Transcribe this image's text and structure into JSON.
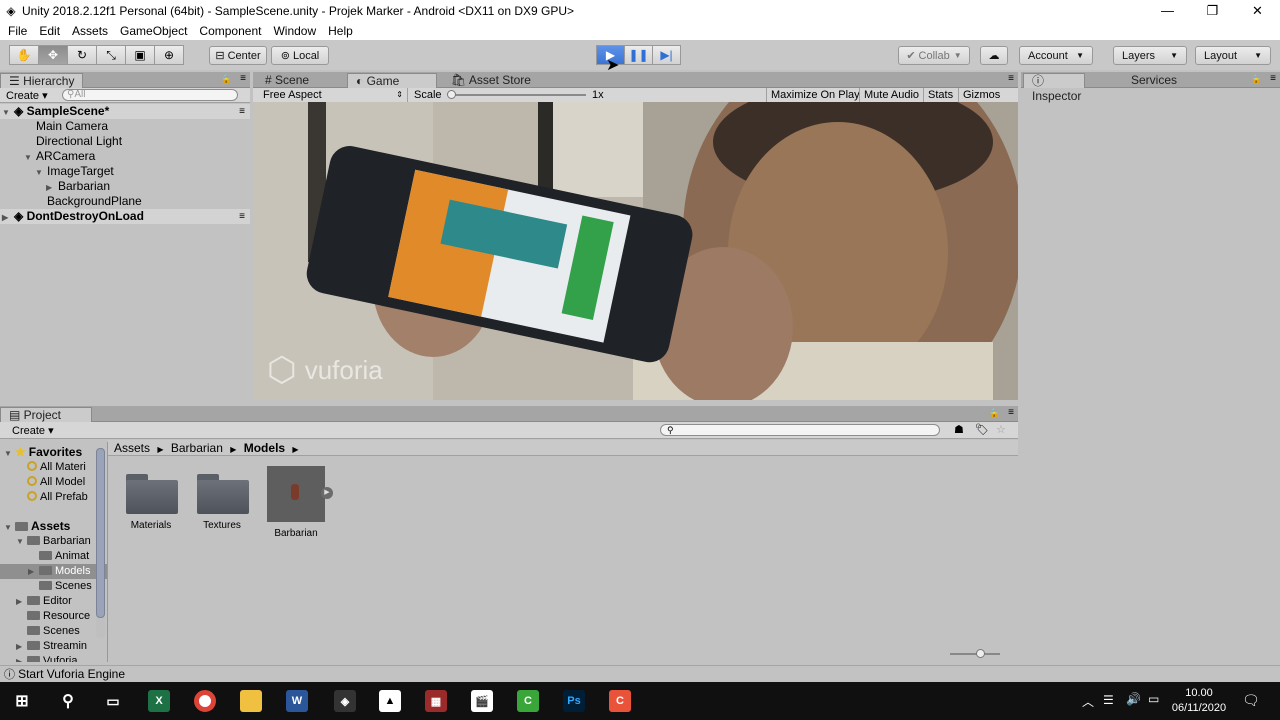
{
  "window": {
    "title": "Unity 2018.2.12f1 Personal (64bit) - SampleScene.unity - Projek Marker - Android <DX11 on DX9 GPU>",
    "controls": [
      "—",
      "❐",
      "✕"
    ]
  },
  "menu": [
    "File",
    "Edit",
    "Assets",
    "GameObject",
    "Component",
    "Window",
    "Help"
  ],
  "toolbar": {
    "center_label": "Center",
    "local_label": "Local",
    "collab_label": "Collab",
    "account_label": "Account",
    "layers_label": "Layers",
    "layout_label": "Layout"
  },
  "hierarchy": {
    "tab": "Hierarchy",
    "create": "Create",
    "search_placeholder": "All",
    "items": [
      {
        "label": "SampleScene*",
        "indent": 0,
        "arrow": "▼",
        "scene": true
      },
      {
        "label": "Main Camera",
        "indent": 2,
        "arrow": ""
      },
      {
        "label": "Directional Light",
        "indent": 2,
        "arrow": ""
      },
      {
        "label": "ARCamera",
        "indent": 2,
        "arrow": "▼"
      },
      {
        "label": "ImageTarget",
        "indent": 3,
        "arrow": "▼"
      },
      {
        "label": "Barbarian",
        "indent": 4,
        "arrow": "▶"
      },
      {
        "label": "BackgroundPlane",
        "indent": 3,
        "arrow": ""
      },
      {
        "label": "DontDestroyOnLoad",
        "indent": 0,
        "arrow": "▶",
        "scene": true
      }
    ]
  },
  "view_tabs": {
    "scene": "Scene",
    "game": "Game",
    "asset_store": "Asset Store"
  },
  "game": {
    "aspect": "Free Aspect",
    "scale_label": "Scale",
    "scale_value": "1x",
    "maximize": "Maximize On Play",
    "mute": "Mute Audio",
    "stats": "Stats",
    "gizmos": "Gizmos",
    "watermark": "vuforia"
  },
  "inspector": {
    "tab": "Inspector",
    "services_tab": "Services"
  },
  "project": {
    "tab": "Project",
    "create": "Create",
    "breadcrumb": [
      "Assets",
      "Barbarian",
      "Models"
    ],
    "favorites": {
      "label": "Favorites",
      "items": [
        "All Materi",
        "All Model",
        "All Prefab"
      ]
    },
    "assets": {
      "label": "Assets",
      "items": [
        {
          "label": "Barbarian",
          "indent": 1,
          "arrow": "▼"
        },
        {
          "label": "Animat",
          "indent": 2,
          "arrow": ""
        },
        {
          "label": "Models",
          "indent": 2,
          "arrow": "▶",
          "selected": true
        },
        {
          "label": "Scenes",
          "indent": 2,
          "arrow": ""
        },
        {
          "label": "Editor",
          "indent": 1,
          "arrow": "▶"
        },
        {
          "label": "Resource",
          "indent": 1,
          "arrow": ""
        },
        {
          "label": "Scenes",
          "indent": 1,
          "arrow": ""
        },
        {
          "label": "Streamin",
          "indent": 1,
          "arrow": "▶"
        },
        {
          "label": "Vuforia",
          "indent": 1,
          "arrow": "▶"
        }
      ]
    },
    "grid_items": [
      "Materials",
      "Textures",
      "Barbarian"
    ]
  },
  "status": {
    "text": "Start Vuforia Engine"
  },
  "taskbar": {
    "time": "10.00",
    "date": "06/11/2020"
  }
}
